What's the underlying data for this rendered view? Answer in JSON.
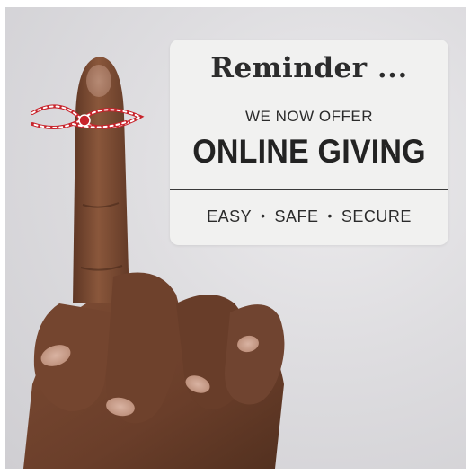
{
  "card": {
    "title": "Reminder ...",
    "subtitle": "WE NOW OFFER",
    "headline": "ONLINE GIVING",
    "features": [
      "EASY",
      "SAFE",
      "SECURE"
    ],
    "separator": "•"
  },
  "image": {
    "subject": "hand-finger-with-string",
    "colors": {
      "background": "#dedde0",
      "card": "#f1f1f0",
      "skin": "#7a4a33",
      "string_red": "#c8242c",
      "text": "#232323"
    }
  }
}
